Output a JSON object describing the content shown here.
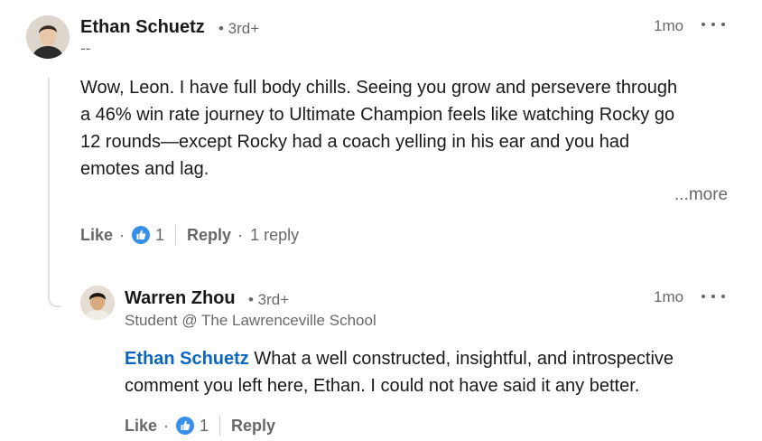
{
  "comment": {
    "author": "Ethan Schuetz",
    "degree": "• 3rd+",
    "headline": "--",
    "time": "1mo",
    "menu_icon": "more-horizontal-icon",
    "body_lines": [
      "Wow, Leon. I have full body chills. Seeing you grow and persevere through",
      "a 46% win rate journey to Ultimate Champion feels like watching Rocky go",
      "12 rounds—except Rocky had a coach yelling in his ear and you had",
      "emotes and lag."
    ],
    "more": "...more",
    "actions": {
      "like": "Like",
      "reaction_icon": "like-reaction-icon",
      "reaction_count": "1",
      "reply": "Reply",
      "replies": "1 reply"
    }
  },
  "reply": {
    "author": "Warren Zhou",
    "degree": "• 3rd+",
    "headline": "Student @ The Lawrenceville School",
    "time": "1mo",
    "menu_icon": "more-horizontal-icon",
    "mention": "Ethan Schuetz",
    "body_line1_rest": " What a well constructed, insightful, and introspective",
    "body_line2": "comment you left here, Ethan. I could not have said it any better.",
    "actions": {
      "like": "Like",
      "reaction_icon": "like-reaction-icon",
      "reaction_count": "1",
      "reply": "Reply"
    }
  },
  "colors": {
    "mention": "#0a66c2",
    "like_badge": "#378fe9"
  }
}
